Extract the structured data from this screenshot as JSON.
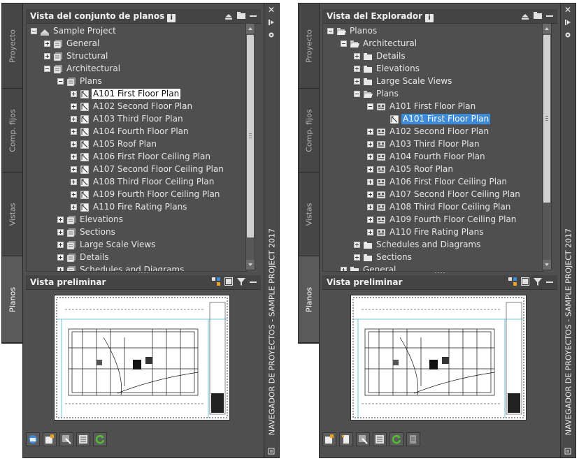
{
  "left": {
    "sidetabs": [
      "Proyecto",
      "Comp. fijos",
      "Vistas",
      "Planos"
    ],
    "active_tab": "Planos",
    "tree_title": "Vista del conjunto de planos",
    "tree": [
      {
        "label": "Sample Project",
        "depth": 0,
        "exp": "minus",
        "icon": "sheetset-icon"
      },
      {
        "label": "General",
        "depth": 1,
        "exp": "plus",
        "icon": "sheet-stack-icon"
      },
      {
        "label": "Structural",
        "depth": 1,
        "exp": "plus",
        "icon": "sheet-stack-icon"
      },
      {
        "label": "Architectural",
        "depth": 1,
        "exp": "minus",
        "icon": "sheet-stack-icon"
      },
      {
        "label": "Plans",
        "depth": 2,
        "exp": "minus",
        "icon": "sheet-stack-icon"
      },
      {
        "label": "A101 First Floor Plan",
        "depth": 3,
        "exp": "plus",
        "icon": "sheet-icon",
        "selected": "white"
      },
      {
        "label": "A102 Second Floor Plan",
        "depth": 3,
        "exp": "plus",
        "icon": "sheet-icon"
      },
      {
        "label": "A103 Third Floor Plan",
        "depth": 3,
        "exp": "plus",
        "icon": "sheet-icon"
      },
      {
        "label": "A104 Fourth Floor Plan",
        "depth": 3,
        "exp": "plus",
        "icon": "sheet-icon"
      },
      {
        "label": "A105 Roof Plan",
        "depth": 3,
        "exp": "plus",
        "icon": "sheet-icon"
      },
      {
        "label": "A106 First Floor Ceiling Plan",
        "depth": 3,
        "exp": "plus",
        "icon": "sheet-icon"
      },
      {
        "label": "A107 Second Floor Ceiling Plan",
        "depth": 3,
        "exp": "plus",
        "icon": "sheet-icon"
      },
      {
        "label": "A108 Third Floor Ceiling Plan",
        "depth": 3,
        "exp": "plus",
        "icon": "sheet-icon"
      },
      {
        "label": "A109 Fourth Floor Ceiling Plan",
        "depth": 3,
        "exp": "plus",
        "icon": "sheet-icon"
      },
      {
        "label": "A110 Fire Rating Plans",
        "depth": 3,
        "exp": "plus",
        "icon": "sheet-icon"
      },
      {
        "label": "Elevations",
        "depth": 2,
        "exp": "plus",
        "icon": "sheet-stack-icon"
      },
      {
        "label": "Sections",
        "depth": 2,
        "exp": "plus",
        "icon": "sheet-stack-icon"
      },
      {
        "label": "Large Scale Views",
        "depth": 2,
        "exp": "plus",
        "icon": "sheet-stack-icon"
      },
      {
        "label": "Details",
        "depth": 2,
        "exp": "plus",
        "icon": "sheet-stack-icon"
      },
      {
        "label": "Schedules and Diagrams",
        "depth": 2,
        "exp": "plus",
        "icon": "sheet-stack-icon"
      }
    ],
    "preview_title": "Vista preliminar",
    "palette_title": "NAVEGADOR DE PROYECTOS - SAMPLE PROJECT 2017"
  },
  "right": {
    "sidetabs": [
      "Proyecto",
      "Comp. fijos",
      "Vistas",
      "Planos"
    ],
    "active_tab": "Planos",
    "tree_title": "Vista del Explorador",
    "tree": [
      {
        "label": "Planos",
        "depth": 0,
        "exp": "minus",
        "icon": "open-folder-icon"
      },
      {
        "label": "Architectural",
        "depth": 1,
        "exp": "minus",
        "icon": "open-folder-icon"
      },
      {
        "label": "Details",
        "depth": 2,
        "exp": "plus",
        "icon": "folder-icon"
      },
      {
        "label": "Elevations",
        "depth": 2,
        "exp": "plus",
        "icon": "folder-icon"
      },
      {
        "label": "Large Scale Views",
        "depth": 2,
        "exp": "plus",
        "icon": "folder-icon"
      },
      {
        "label": "Plans",
        "depth": 2,
        "exp": "minus",
        "icon": "open-folder-icon"
      },
      {
        "label": "A101 First Floor Plan",
        "depth": 3,
        "exp": "minus",
        "icon": "drawing-file-icon"
      },
      {
        "label": "A101 First Floor Plan",
        "depth": 4,
        "exp": "none",
        "icon": "sheet-icon",
        "selected": "blue"
      },
      {
        "label": "A102 Second Floor Plan",
        "depth": 3,
        "exp": "plus",
        "icon": "drawing-file-icon"
      },
      {
        "label": "A103 Third Floor Plan",
        "depth": 3,
        "exp": "plus",
        "icon": "drawing-file-icon"
      },
      {
        "label": "A104 Fourth Floor Plan",
        "depth": 3,
        "exp": "plus",
        "icon": "drawing-file-icon"
      },
      {
        "label": "A105 Roof Plan",
        "depth": 3,
        "exp": "plus",
        "icon": "drawing-file-icon"
      },
      {
        "label": "A106 First Floor Ceiling Plan",
        "depth": 3,
        "exp": "plus",
        "icon": "drawing-file-icon"
      },
      {
        "label": "A107 Second Floor Ceiling Plan",
        "depth": 3,
        "exp": "plus",
        "icon": "drawing-file-icon"
      },
      {
        "label": "A108 Third Floor Ceiling Plan",
        "depth": 3,
        "exp": "plus",
        "icon": "drawing-file-icon"
      },
      {
        "label": "A109 Fourth Floor Ceiling Plan",
        "depth": 3,
        "exp": "plus",
        "icon": "drawing-file-icon"
      },
      {
        "label": "A110 Fire Rating Plans",
        "depth": 3,
        "exp": "plus",
        "icon": "drawing-file-icon"
      },
      {
        "label": "Schedules and Diagrams",
        "depth": 2,
        "exp": "plus",
        "icon": "folder-icon"
      },
      {
        "label": "Sections",
        "depth": 2,
        "exp": "plus",
        "icon": "folder-icon"
      },
      {
        "label": "General",
        "depth": 1,
        "exp": "plus",
        "icon": "folder-icon"
      }
    ],
    "preview_title": "Vista preliminar",
    "palette_title": "NAVEGADOR DE PROYECTOS - SAMPLE PROJECT 2017"
  },
  "colors": {
    "panel_bg": "#4f4f4f",
    "header_bg": "#444444",
    "selection_blue": "#3c8ad8",
    "selection_white": "#ffffff",
    "text": "#e6e6e6"
  }
}
